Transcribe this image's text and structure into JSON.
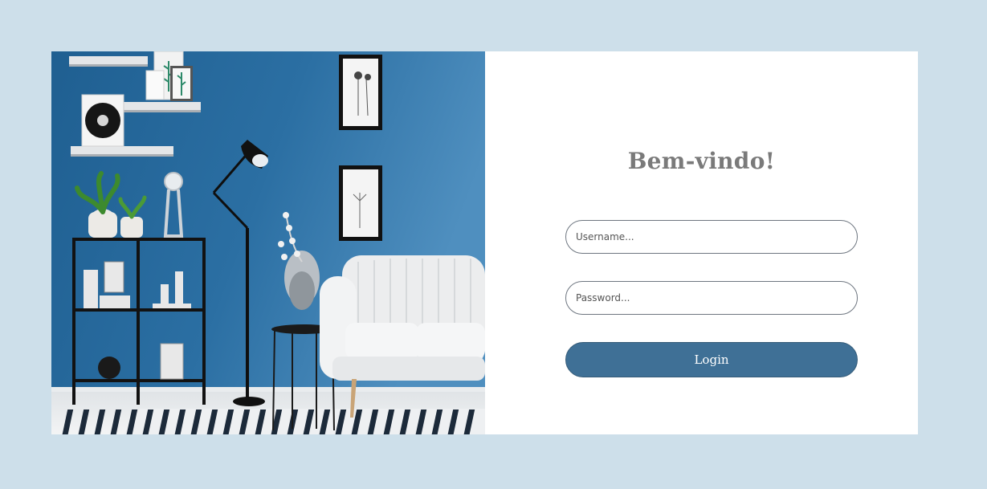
{
  "login": {
    "heading": "Bem-vindo!",
    "username_placeholder": "Username...",
    "password_placeholder": "Password...",
    "login_label": "Login"
  },
  "colors": {
    "page_background": "#cddfea",
    "wall_blue": "#2e6f9f",
    "button_blue": "#3f7096"
  }
}
